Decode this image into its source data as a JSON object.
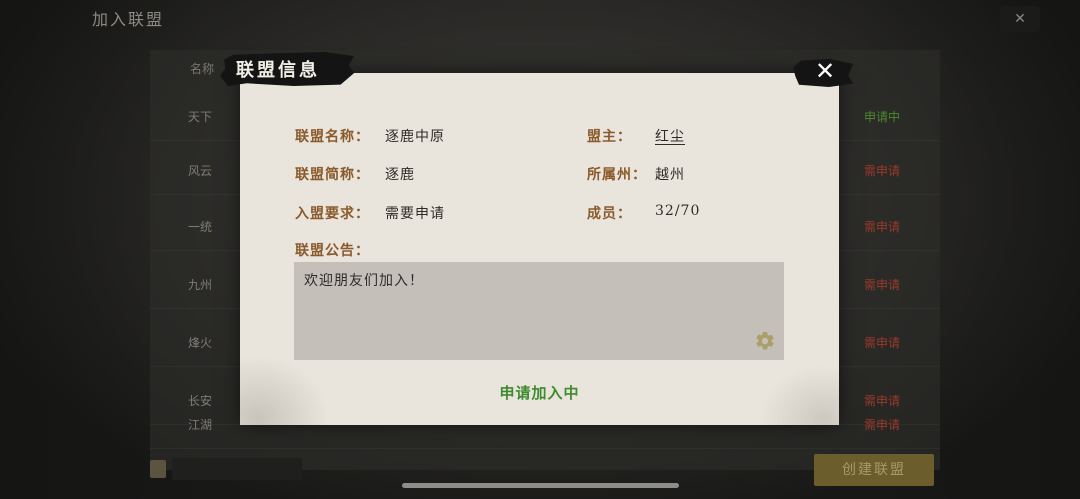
{
  "background": {
    "title": "加入联盟",
    "header_text": "名称",
    "rows": [
      {
        "name": "天下",
        "tag": "申请中"
      },
      {
        "name": "风云",
        "tag": "需申请"
      },
      {
        "name": "一统",
        "tag": "需申请"
      },
      {
        "name": "九州",
        "tag": "需申请"
      },
      {
        "name": "烽火",
        "tag": "需申请"
      },
      {
        "name": "长安",
        "tag": "需申请"
      },
      {
        "name": "江湖",
        "tag": "需申请"
      }
    ],
    "bottom_button": "创建联盟"
  },
  "dialog": {
    "title": "联盟信息",
    "labels": {
      "name": "联盟名称：",
      "short_name": "联盟简称：",
      "requirement": "入盟要求：",
      "leader": "盟主：",
      "state": "所属州：",
      "members": "成员：",
      "notice": "联盟公告："
    },
    "values": {
      "name": "逐鹿中原",
      "short_name": "逐鹿",
      "requirement": "需要申请",
      "leader": "红尘",
      "state": "越州",
      "members": "32/70",
      "notice": "欢迎朋友们加入！"
    },
    "status": "申请加入中"
  },
  "colors": {
    "label": "#8a5a2b",
    "status_green": "#3f8a2d",
    "dialog_bg": "#e9e5dd",
    "notice_bg": "#c4c0b9"
  },
  "icons": {
    "close": "close-icon",
    "settings": "gear-icon"
  }
}
